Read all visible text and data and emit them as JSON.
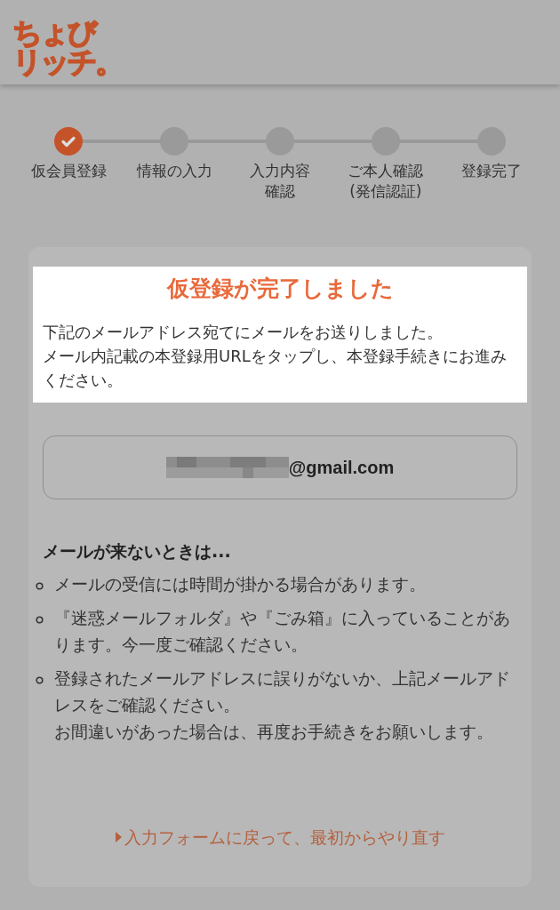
{
  "header": {
    "logo_lines": [
      "ちょび",
      "リッチ。"
    ]
  },
  "steps": [
    {
      "lines": [
        "仮会員登録"
      ],
      "done": true
    },
    {
      "lines": [
        "情報の入力"
      ],
      "done": false
    },
    {
      "lines": [
        "入力内容",
        "確認"
      ],
      "done": false
    },
    {
      "lines": [
        "ご本人確認",
        "(発信認証)"
      ],
      "done": false
    },
    {
      "lines": [
        "登録完了"
      ],
      "done": false
    }
  ],
  "notice": {
    "title": "仮登録が完了しました",
    "paragraphs": [
      "下記のメールアドレス宛てにメールをお送りしました。",
      "メール内記載の本登録用URLをタップし、本登録手続きにお進みください。"
    ]
  },
  "email": {
    "value": "@gmail.com"
  },
  "help": {
    "heading": "メールが来ないときは...",
    "items": [
      {
        "paragraphs": [
          "メールの受信には時間が掛かる場合があります。"
        ]
      },
      {
        "paragraphs": [
          "『迷惑メールフォルダ』や『ごみ箱』に入っていることがあります。今一度ご確認ください。"
        ]
      },
      {
        "paragraphs": [
          "登録されたメールアドレスに誤りがないか、上記メールアドレスをご確認ください。",
          "お間違いがあった場合は、再度お手続きをお願いします。"
        ]
      }
    ]
  },
  "link": {
    "label": "入力フォームに戻って、最初からやり直す"
  }
}
